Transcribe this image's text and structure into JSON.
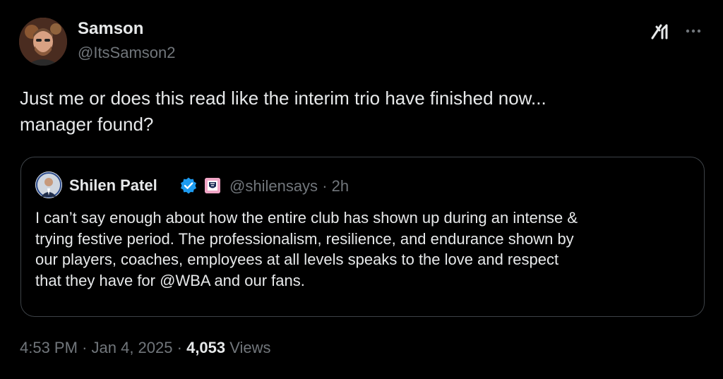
{
  "author": {
    "name": "Samson",
    "handle": "@ItsSamson2",
    "avatar_icon": "profile-photo"
  },
  "header_actions": {
    "grok_icon": "grok-icon",
    "more_icon": "more-options-icon"
  },
  "tweet": {
    "text": "Just me or does this read like the interim trio have finished now...\nmanager found?"
  },
  "quote": {
    "author_name": "Shilen Patel",
    "verified_icon": "verified-badge-icon",
    "affiliate_icon": "club-affiliate-badge",
    "handle": "@shilensays",
    "separator": "·",
    "time": "2h",
    "text": "I can’t say enough about how the entire club has shown up during an intense &\ntrying festive period. The professionalism, resilience, and endurance shown by\nour players, coaches, employees at all levels speaks to the love and respect\nthat they have for @WBA and our fans."
  },
  "meta": {
    "time": "4:53 PM",
    "sep1": "·",
    "date": "Jan 4, 2025",
    "sep2": "·",
    "views_count": "4,053",
    "views_label": "Views"
  },
  "colors": {
    "background": "#000000",
    "text_primary": "#e7e9ea",
    "text_secondary": "#71767b",
    "border": "#3d4247",
    "verified_blue": "#1d9bf0"
  }
}
